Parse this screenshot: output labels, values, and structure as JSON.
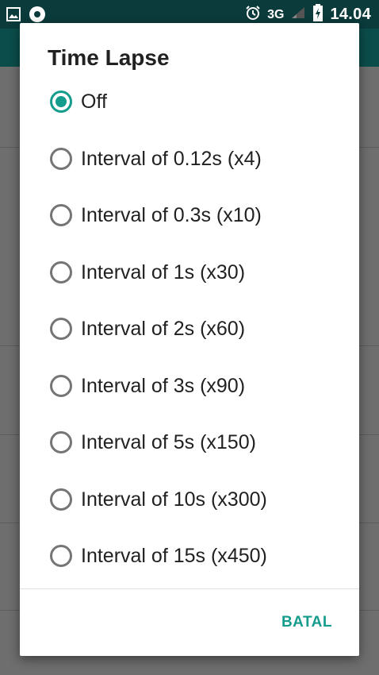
{
  "status_bar": {
    "network": "3G",
    "time": "14.04"
  },
  "dialog": {
    "title": "Time Lapse",
    "options": [
      {
        "label": "Off",
        "checked": true
      },
      {
        "label": "Interval of 0.12s (x4)",
        "checked": false
      },
      {
        "label": "Interval of 0.3s (x10)",
        "checked": false
      },
      {
        "label": "Interval of 1s (x30)",
        "checked": false
      },
      {
        "label": "Interval of 2s (x60)",
        "checked": false
      },
      {
        "label": "Interval of 3s (x90)",
        "checked": false
      },
      {
        "label": "Interval of 5s (x150)",
        "checked": false
      },
      {
        "label": "Interval of 10s (x300)",
        "checked": false
      },
      {
        "label": "Interval of 15s (x450)",
        "checked": false
      }
    ],
    "cancel_label": "BATAL"
  },
  "colors": {
    "accent": "#159c8c",
    "toolbar": "#0b4d4a",
    "radio_unchecked": "#757575"
  }
}
